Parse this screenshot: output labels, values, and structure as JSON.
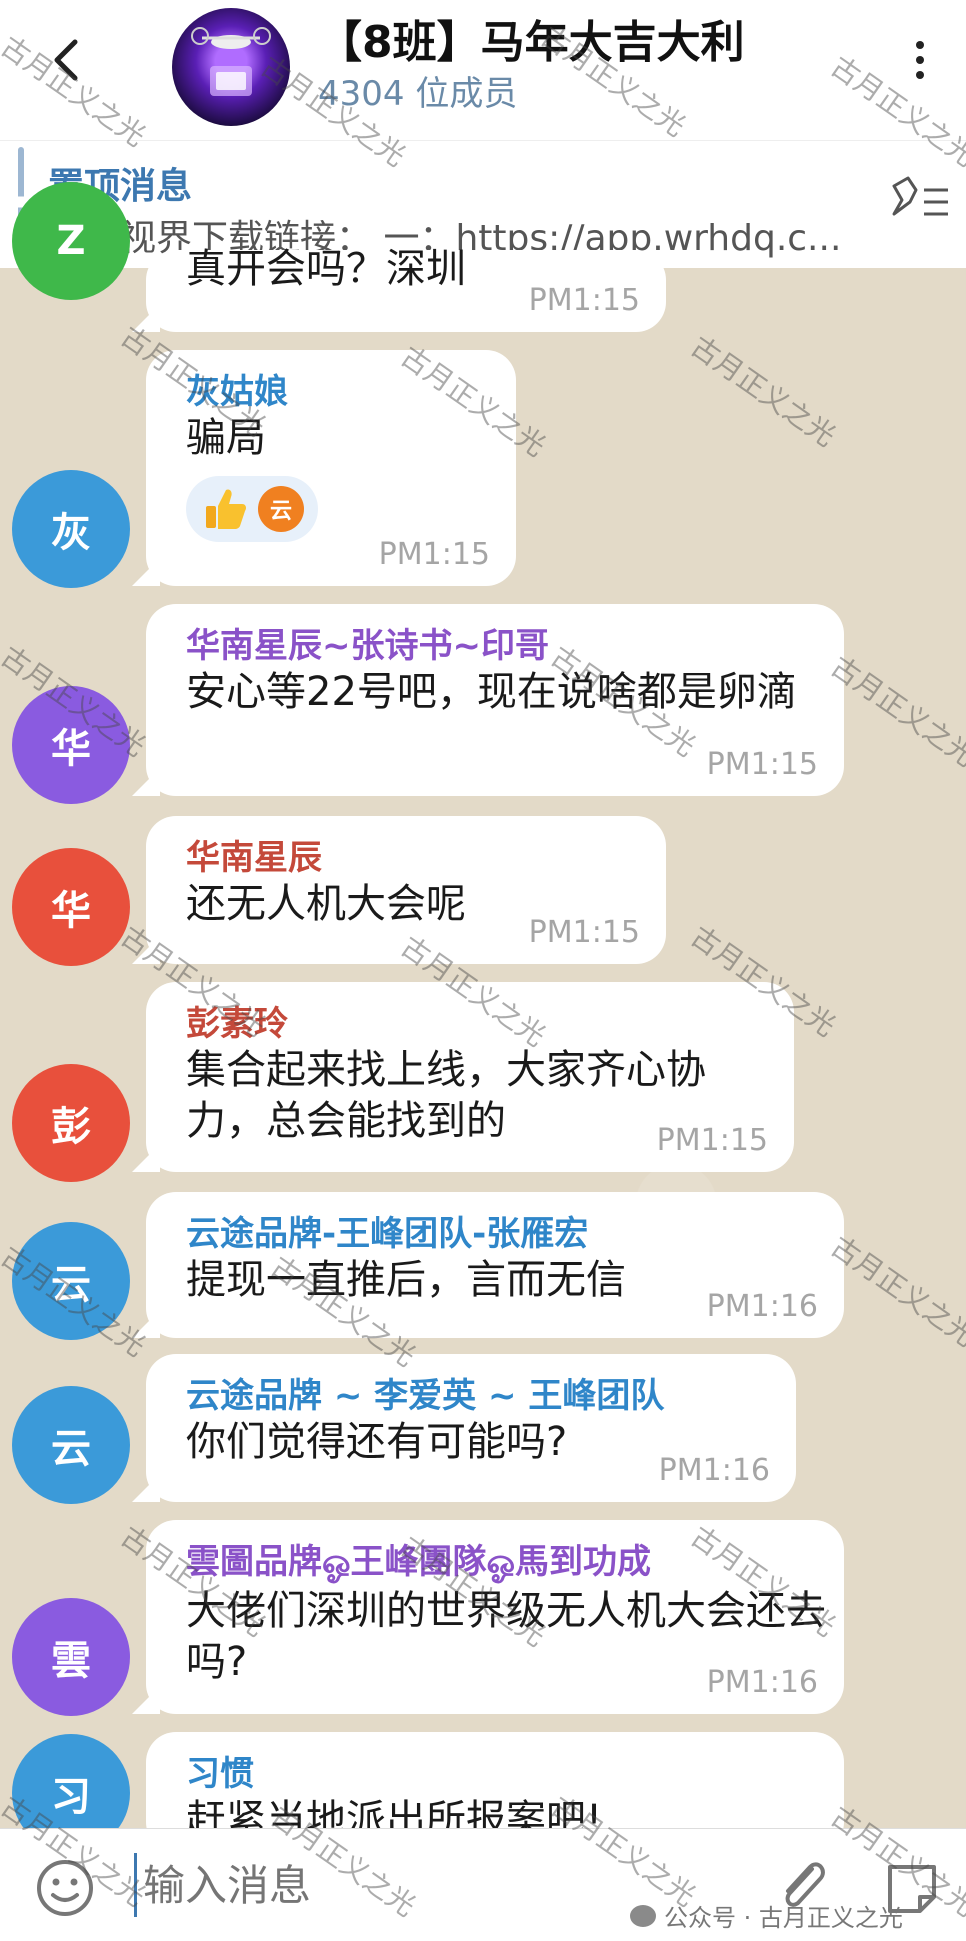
{
  "header": {
    "title": "【8班】马年大吉大利",
    "member_count": "4304 位成员"
  },
  "pinned": {
    "title": "置顶消息",
    "text": "智航视界下载链接：  一：https://app.wrhdq.c..."
  },
  "messages": [
    {
      "avatar": "Z",
      "avatar_color": "#3fb84a",
      "sender": "",
      "sender_color": "#333",
      "text": "真开会吗？深圳",
      "time": "PM1:15"
    },
    {
      "avatar": "灰",
      "avatar_color": "#3b9ad9",
      "sender": "灰姑娘",
      "sender_color": "#2f86c9",
      "text": "骗局",
      "time": "PM1:15",
      "reaction_avatar": "云"
    },
    {
      "avatar": "华",
      "avatar_color": "#8a5be0",
      "sender": "华南星辰~张诗书~印哥",
      "sender_color": "#8a52c8",
      "text": "安心等22号吧，现在说啥都是卵滴",
      "time": "PM1:15"
    },
    {
      "avatar": "华",
      "avatar_color": "#e8503c",
      "sender": "华南星辰",
      "sender_color": "#c4493a",
      "text": "还无人机大会呢",
      "time": "PM1:15"
    },
    {
      "avatar": "彭",
      "avatar_color": "#e8503c",
      "sender": "彭素玲",
      "sender_color": "#c4493a",
      "text": "集合起来找上线，大家齐心协力，总会能找到的",
      "time": "PM1:15"
    },
    {
      "avatar": "云",
      "avatar_color": "#3b9ad9",
      "sender": "云途品牌-王峰团队-张雁宏",
      "sender_color": "#2f86c9",
      "text": "提现一直推后，言而无信",
      "time": "PM1:16"
    },
    {
      "avatar": "云",
      "avatar_color": "#3b9ad9",
      "sender": "云途品牌 ~ 李爱英 ~ 王峰团队",
      "sender_color": "#2f86c9",
      "text": "你们觉得还有可能吗?",
      "time": "PM1:16"
    },
    {
      "avatar": "雲",
      "avatar_color": "#8a5be0",
      "sender": "雲圖品牌ஓ王峰團隊ஓ馬到功成",
      "sender_color": "#8a52c8",
      "text": "大佬们深圳的世界级无人机大会还去吗?",
      "time": "PM1:16"
    },
    {
      "avatar": "习",
      "avatar_color": "#3b9ad9",
      "sender": "习惯",
      "sender_color": "#2f86c9",
      "text": "赶紧当地派出所报案吧!",
      "time": ""
    }
  ],
  "input": {
    "placeholder": "输入消息"
  },
  "credit": "公众号 · 古月正义之光",
  "watermark": "古月正义之光",
  "icons": [
    "back-icon",
    "more-icon",
    "pin-list-icon",
    "emoji-icon",
    "attach-icon",
    "sticker-icon",
    "thumbs-up-icon"
  ]
}
